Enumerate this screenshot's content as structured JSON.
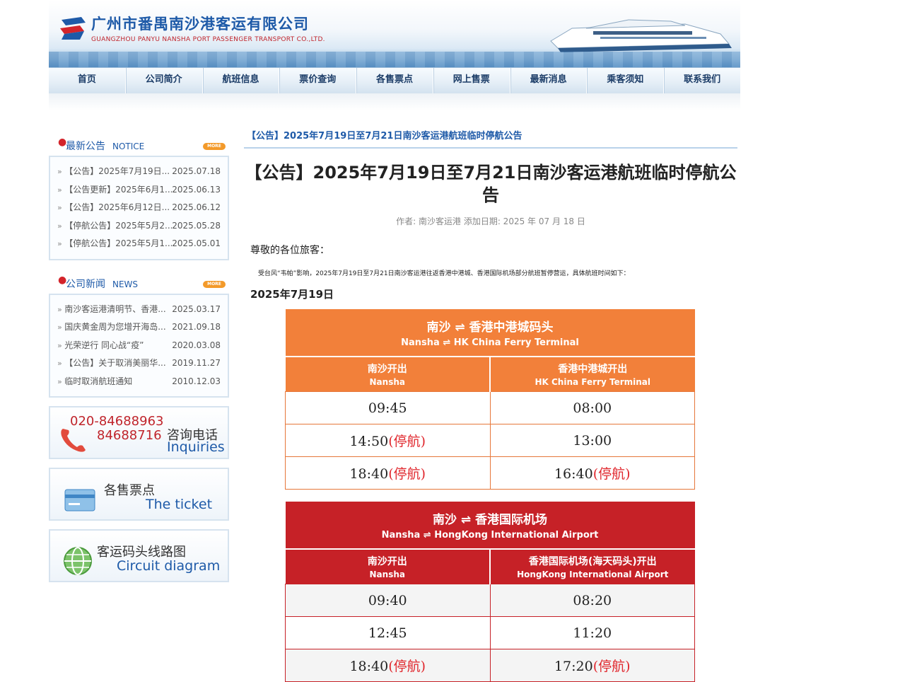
{
  "company": {
    "name_cn": "广州市番禺南沙港客运有限公司",
    "name_en": "GUANGZHOU PANYU NANSHA PORT PASSENGER TRANSPORT CO.,LTD."
  },
  "nav": [
    "首页",
    "公司简介",
    "航班信息",
    "票价查询",
    "各售票点",
    "网上售票",
    "最新消息",
    "乘客须知",
    "联系我们"
  ],
  "sidebar": {
    "notice": {
      "title_cn": "最新公告",
      "title_en": "NOTICE",
      "more": "MORE",
      "items": [
        {
          "title": "【公告】2025年7月19日...",
          "date": "2025.07.18"
        },
        {
          "title": "【公告更新】2025年6月1...",
          "date": "2025.06.13"
        },
        {
          "title": "【公告】2025年6月12日...",
          "date": "2025.06.12"
        },
        {
          "title": "【停航公告】2025年5月2...",
          "date": "2025.05.28"
        },
        {
          "title": "【停航公告】2025年5月1...",
          "date": "2025.05.01"
        }
      ]
    },
    "news": {
      "title_cn": "公司新闻",
      "title_en": "NEWS",
      "more": "MORE",
      "items": [
        {
          "title": "南沙客运港清明节、香港...",
          "date": "2025.03.17"
        },
        {
          "title": "国庆黄金周为您增开海岛...",
          "date": "2021.09.18"
        },
        {
          "title": "光荣逆行 同心战“疫”",
          "date": "2020.03.08"
        },
        {
          "title": "【公告】关于取消美丽华...",
          "date": "2019.11.27"
        },
        {
          "title": "临时取消航班通知",
          "date": "2010.12.03"
        }
      ]
    },
    "phone": {
      "line1": "020-84688963",
      "line2": "84688716",
      "label_cn": "咨询电话",
      "label_en": "Inquiries"
    },
    "ticket": {
      "label_cn": "各售票点",
      "label_en": "The ticket"
    },
    "circuit": {
      "label_cn": "客运码头线路图",
      "label_en": "Circuit diagram"
    }
  },
  "article": {
    "breadcrumb": "【公告】2025年7月19日至7月21日南沙客运港航班临时停航公告",
    "title": "【公告】2025年7月19日至7月21日南沙客运港航班临时停航公告",
    "meta": "作者: 南沙客运港    添加日期: 2025 年 07 月 18 日",
    "greeting": "尊敬的各位旅客：",
    "intro": "受台风“韦帕”影响，2025年7月19日至7月21日南沙客运港往返香港中港城、香港国际机场部分航班暂停营运，具体航班时间如下：",
    "date": "2025年7月19日"
  },
  "table1": {
    "route_cn": "南沙  ⇌  香港中港城码头",
    "route_en": "Nansha  ⇌  HK China Ferry Terminal",
    "col1_cn": "南沙开出",
    "col1_en": "Nansha",
    "col2_cn": "香港中港城开出",
    "col2_en": "HK China Ferry Terminal",
    "rows": [
      {
        "a": "09:45",
        "a_stop": "",
        "b": "08:00",
        "b_stop": ""
      },
      {
        "a": "14:50",
        "a_stop": "(停航)",
        "b": "13:00",
        "b_stop": ""
      },
      {
        "a": "18:40",
        "a_stop": "(停航)",
        "b": "16:40",
        "b_stop": "(停航)"
      }
    ]
  },
  "table2": {
    "route_cn": "南沙  ⇌  香港国际机场",
    "route_en": "Nansha  ⇌  HongKong International Airport",
    "col1_cn": "南沙开出",
    "col1_en": "Nansha",
    "col2_cn": "香港国际机场(海天码头)开出",
    "col2_en": "HongKong International Airport",
    "rows": [
      {
        "a": "09:40",
        "a_stop": "",
        "b": "08:20",
        "b_stop": ""
      },
      {
        "a": "12:45",
        "a_stop": "",
        "b": "11:20",
        "b_stop": ""
      },
      {
        "a": "18:40",
        "a_stop": "(停航)",
        "b": "17:20",
        "b_stop": "(停航)"
      }
    ]
  },
  "colors": {
    "brand_blue": "#1e5aa8",
    "orange": "#f2803a",
    "red": "#c62127",
    "stop_red": "#e0262c"
  }
}
